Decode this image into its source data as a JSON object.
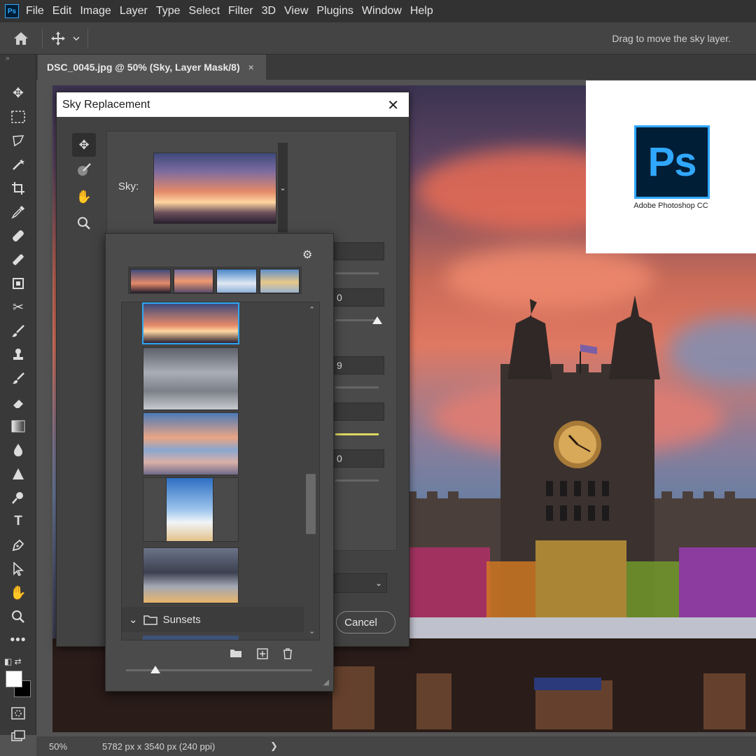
{
  "menubar": {
    "app_icon": "Ps",
    "items": [
      "File",
      "Edit",
      "Image",
      "Layer",
      "Type",
      "Select",
      "Filter",
      "3D",
      "View",
      "Plugins",
      "Window",
      "Help"
    ]
  },
  "options_bar": {
    "hint": "Drag to move the sky layer."
  },
  "document": {
    "tab_title": "DSC_0045.jpg @ 50% (Sky, Layer Mask/8)",
    "tab_close": "×"
  },
  "status_bar": {
    "zoom": "50%",
    "doc_info": "5782 px x 3540 px (240 ppi)",
    "arrow": "❯"
  },
  "logo": {
    "mark": "Ps",
    "caption": "Adobe Photoshop CC"
  },
  "dialog": {
    "title": "Sky Replacement",
    "close": "✕",
    "sky_label": "Sky:",
    "dropdown_arrow": "⌄",
    "fields": [
      "0",
      "9",
      "0"
    ],
    "cancel_label": "Cancel",
    "select_arrow": "⌄"
  },
  "sky_popup": {
    "gear": "⚙",
    "folder_name": "Sunsets",
    "folder_chevron": "⌄",
    "scroll_up": "⌃",
    "scroll_down": "⌄"
  },
  "colors": {
    "accent": "#31a8ff",
    "selection": "#2fa6f3",
    "highlight_slider": "#e0d860"
  }
}
